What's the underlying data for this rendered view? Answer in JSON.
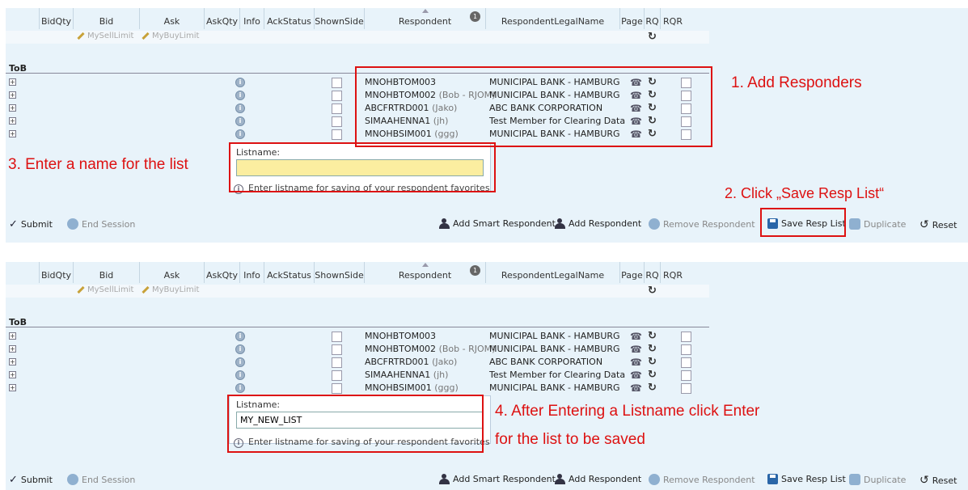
{
  "columns": {
    "bidqty": "BidQty",
    "bid": "Bid",
    "ask": "Ask",
    "askqty": "AskQty",
    "info": "Info",
    "ackstatus": "AckStatus",
    "shownside": "ShownSide",
    "respondent": "Respondent",
    "legalname": "RespondentLegalName",
    "page": "Page",
    "rq": "RQ",
    "rqr": "RQR",
    "respondent_count": "1"
  },
  "limits": {
    "sell": "MySellLimit",
    "buy": "MyBuyLimit"
  },
  "tob_label": "ToB",
  "rows": [
    {
      "respondent": "MNOHBTOM003",
      "alias": "",
      "legal": "MUNICIPAL BANK - HAMBURG"
    },
    {
      "respondent": "MNOHBTOM002",
      "alias": "(Bob - RJOM)",
      "legal": "MUNICIPAL BANK - HAMBURG"
    },
    {
      "respondent": "ABCFRTRD001",
      "alias": "(Jako)",
      "legal": "ABC BANK CORPORATION"
    },
    {
      "respondent": "SIMAAHENNA1",
      "alias": "(jh)",
      "legal": "Test Member for Clearing Data"
    },
    {
      "respondent": "MNOHBSIM001",
      "alias": "(ggg)",
      "legal": "MUNICIPAL BANK - HAMBURG"
    }
  ],
  "popup": {
    "label": "Listname:",
    "value_top": "",
    "value_bottom": "MY_NEW_LIST",
    "hint": "Enter listname for saving of your respondent favorites"
  },
  "toolbar": {
    "submit": "Submit",
    "end_session": "End Session",
    "add_smart": "Add Smart Respondent",
    "add_respondent": "Add Respondent",
    "remove_respondent": "Remove Respondent",
    "save_resp_list": "Save Resp List",
    "duplicate": "Duplicate",
    "reset": "Reset"
  },
  "annotations": {
    "a1": "1. Add Responders",
    "a2": "2. Click „Save Resp List“",
    "a3": "3. Enter a name for the list",
    "a4_line1": "4. After Entering a Listname click Enter",
    "a4_line2": "for the list to be saved"
  },
  "colors": {
    "annotation": "#d11111",
    "panel": "#e8f3fa",
    "input_highlight": "#fbeea0"
  }
}
